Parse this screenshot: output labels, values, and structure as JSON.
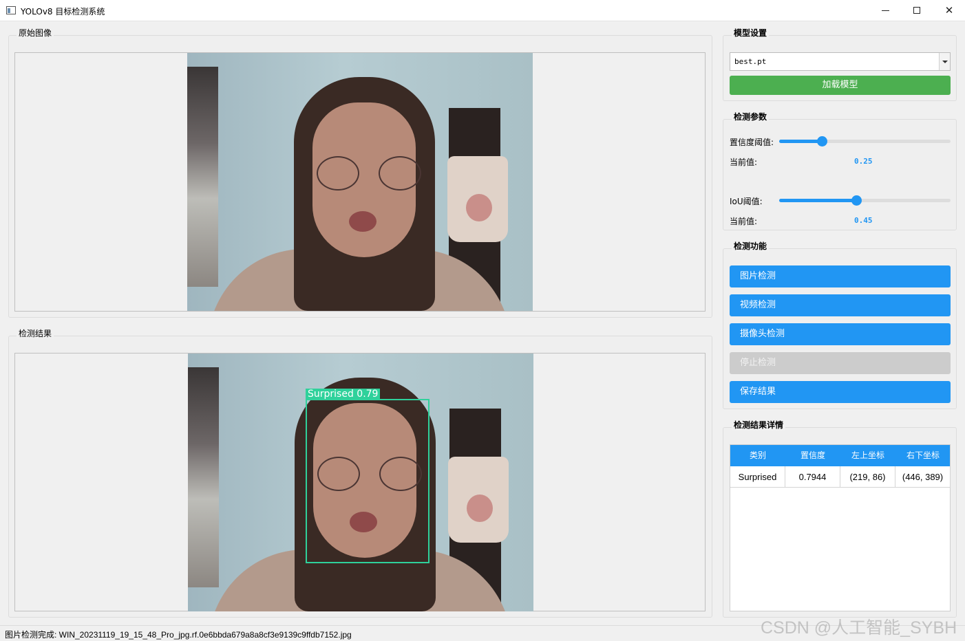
{
  "window": {
    "title": "YOLOv8 目标检测系统",
    "controls": {
      "minimize": "minimize",
      "maximize": "maximize",
      "close": "✕"
    }
  },
  "original_panel": {
    "title": "原始图像"
  },
  "result_panel": {
    "title": "检测结果",
    "box_label": "Surprised  0.79",
    "box_color": "#2fd19b"
  },
  "model": {
    "title": "模型设置",
    "selected_model": "best.pt",
    "load_button": "加载模型",
    "load_button_color": "#4caf50"
  },
  "params": {
    "title": "检测参数",
    "confidence": {
      "label": "置信度阈值:",
      "current_label": "当前值:",
      "value": "0.25",
      "level": 0.25
    },
    "iou": {
      "label": "IoU阈值:",
      "current_label": "当前值:",
      "value": "0.45",
      "level": 0.45
    },
    "accent_color": "#2196f3"
  },
  "functions": {
    "title": "检测功能",
    "image_detect": "图片检测",
    "video_detect": "视频检测",
    "camera_detect": "摄像头检测",
    "stop_detect": "停止检测",
    "save_result": "保存结果"
  },
  "details": {
    "title": "检测结果详情",
    "columns": [
      "类别",
      "置信度",
      "左上坐标",
      "右下坐标"
    ],
    "rows": [
      [
        "Surprised",
        "0.7944",
        "(219, 86)",
        "(446, 389)"
      ]
    ]
  },
  "status": {
    "text": "图片检测完成: WIN_20231119_19_15_48_Pro_jpg.rf.0e6bbda679a8a8cf3e9139c9ffdb7152.jpg"
  },
  "watermark": "CSDN @人工智能_SYBH"
}
